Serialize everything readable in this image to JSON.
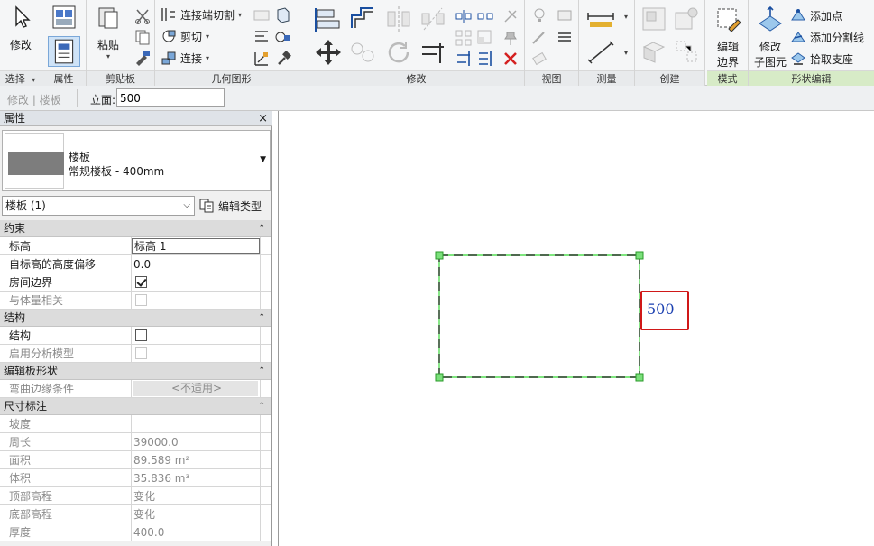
{
  "ribbon": {
    "panels": {
      "select": "选择",
      "properties": "属性",
      "clipboard": "剪贴板",
      "geometry": "几何图形",
      "modify": "修改",
      "view": "视图",
      "measure": "测量",
      "create": "创建",
      "mode": "模式",
      "shape_edit": "形状编辑"
    },
    "buttons": {
      "modify": "修改",
      "paste": "粘贴",
      "cope": "连接端切割",
      "cut": "剪切",
      "join": "连接",
      "edit_boundary_1": "编辑",
      "edit_boundary_2": "边界",
      "modify_sub_1": "修改",
      "modify_sub_2": "子图元",
      "add_point": "添加点",
      "add_split_line": "添加分割线",
      "pick_supports": "拾取支座"
    }
  },
  "options_bar": {
    "breadcrumb": "修改 | 楼板",
    "elevation_label": "立面:",
    "elevation_value": "500"
  },
  "properties": {
    "title": "属性",
    "close": "×",
    "type_family": "楼板",
    "type_name": "常规楼板 - 400mm",
    "instance_filter": "楼板 (1)",
    "edit_type": "编辑类型",
    "groups": {
      "constraints": "约束",
      "structure": "结构",
      "edit_shape": "编辑板形状",
      "dimensions": "尺寸标注"
    },
    "rows": {
      "level_key": "标高",
      "level_val": "标高 1",
      "offset_key": "自标高的高度偏移",
      "offset_val": "0.0",
      "room_boundary_key": "房间边界",
      "mass_key": "与体量相关",
      "structural_key": "结构",
      "analytical_key": "启用分析模型",
      "curved_edge_key": "弯曲边缘条件",
      "curved_edge_val": "<不适用>",
      "slope_key": "坡度",
      "perimeter_key": "周长",
      "perimeter_val": "39000.0",
      "area_key": "面积",
      "area_val": "89.589 m²",
      "volume_key": "体积",
      "volume_val": "35.836 m³",
      "top_elev_key": "顶部高程",
      "top_elev_val": "变化",
      "bottom_elev_key": "底部高程",
      "bottom_elev_val": "变化",
      "thickness_key": "厚度",
      "thickness_val": "400.0"
    },
    "checkboxes": {
      "room_boundary": true,
      "mass": false,
      "structural": false,
      "analytical": false
    }
  },
  "canvas": {
    "dimension_value": "500",
    "colors": {
      "boundary_line": "#1a1a1a",
      "grip": "#55dd55",
      "dimension_text": "#1a3fb0",
      "dimension_box": "#d01818"
    }
  }
}
